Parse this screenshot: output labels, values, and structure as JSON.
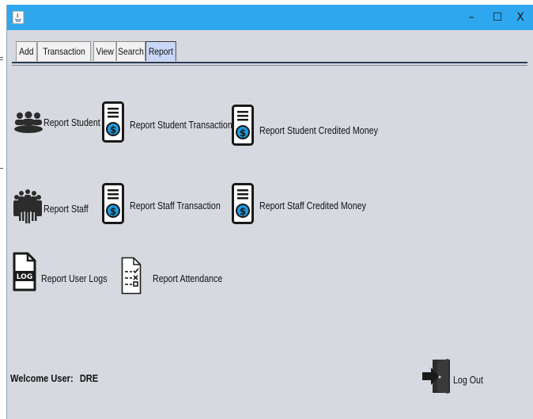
{
  "window": {
    "minimize_glyph": "–",
    "maximize_glyph": "☐",
    "close_glyph": "X"
  },
  "tabs": [
    {
      "label": "Add"
    },
    {
      "label": "Transaction"
    },
    {
      "label": "View"
    },
    {
      "label": "Search"
    },
    {
      "label": "Report",
      "active": true
    }
  ],
  "reports": {
    "student": {
      "label": "Report Student",
      "icon": "students-group-icon"
    },
    "student_transactions": {
      "label": "Report Student Transactions",
      "icon": "receipt-dollar-icon"
    },
    "student_credited": {
      "label": "Report Student Credited Money",
      "icon": "receipt-dollar-icon"
    },
    "staff": {
      "label": "Report Staff",
      "icon": "staff-group-icon"
    },
    "staff_transaction": {
      "label": "Report Staff Transaction",
      "icon": "receipt-dollar-icon"
    },
    "staff_credited": {
      "label": "Report Staff Credited Money",
      "icon": "receipt-dollar-icon"
    },
    "user_logs": {
      "label": "Report User Logs",
      "icon": "log-file-icon"
    },
    "attendance": {
      "label": "Report Attendance",
      "icon": "checklist-icon"
    }
  },
  "footer": {
    "welcome_label": "Welcome User:",
    "username": "DRE",
    "logout_label": "Log Out"
  },
  "colors": {
    "titlebar": "#2ea7ef",
    "background": "#d6d9df",
    "active_tab": "#c9d7f6",
    "dollar_circle": "#1e9be0"
  }
}
